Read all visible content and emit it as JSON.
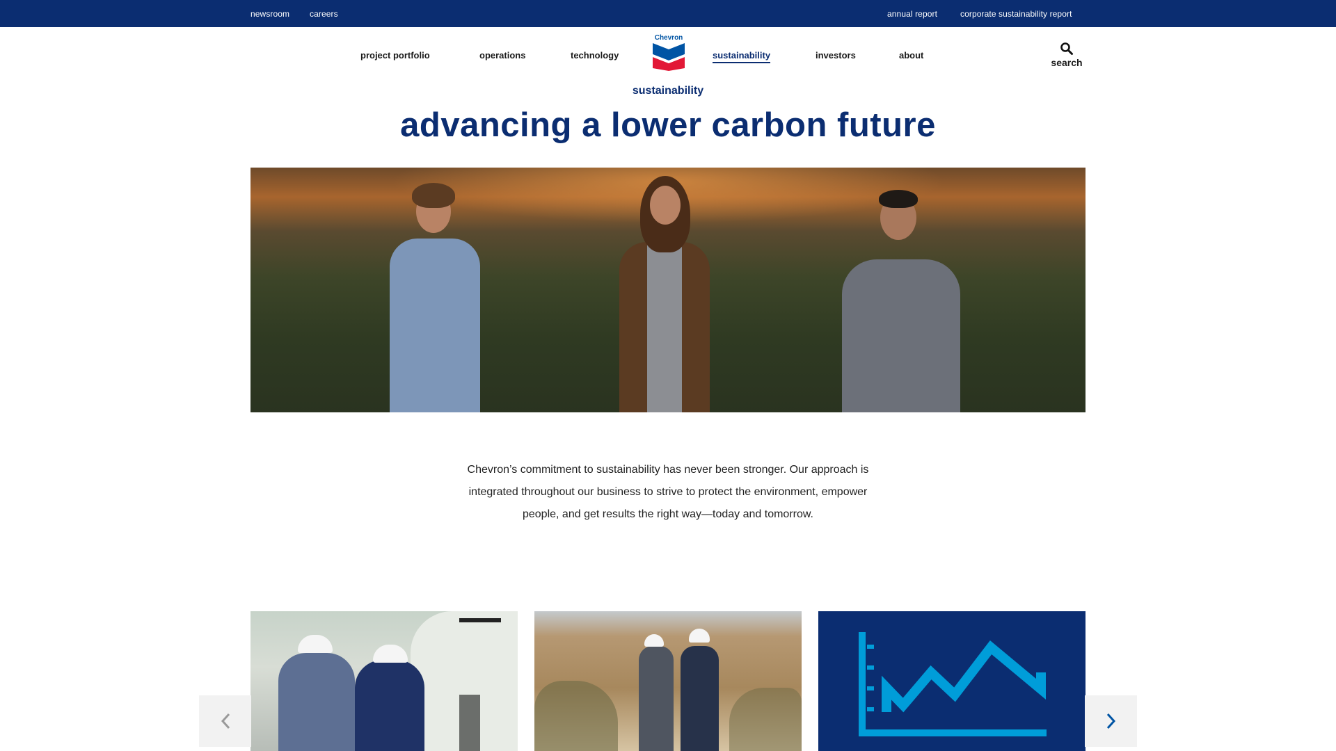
{
  "utility_nav": {
    "left": [
      "newsroom",
      "careers"
    ],
    "right": [
      "annual report",
      "corporate sustainability report"
    ]
  },
  "main_nav": {
    "left": [
      "project portfolio",
      "operations",
      "technology"
    ],
    "right": [
      "sustainability",
      "investors",
      "about"
    ],
    "active": "sustainability"
  },
  "logo": {
    "wordmark": "Chevron"
  },
  "search": {
    "label": "search",
    "icon": "search-icon"
  },
  "page": {
    "eyebrow": "sustainability",
    "title": "advancing a lower carbon future",
    "intro": "Chevron’s commitment to sustainability has never been stronger. Our approach is integrated throughout our business to strive to protect the environment, empower people, and get results the right way—today and tomorrow."
  },
  "carousel": {
    "prev_icon": "chevron-left-icon",
    "next_icon": "chevron-right-icon",
    "cards": [
      {
        "image": "workers-with-drone-photo"
      },
      {
        "image": "workers-in-field-photo"
      },
      {
        "image": "rising-chart-icon"
      }
    ]
  },
  "colors": {
    "brand_navy": "#0b2d71",
    "brand_blue": "#0054a4",
    "brand_red": "#e21836",
    "chart_cyan": "#009dd9"
  }
}
